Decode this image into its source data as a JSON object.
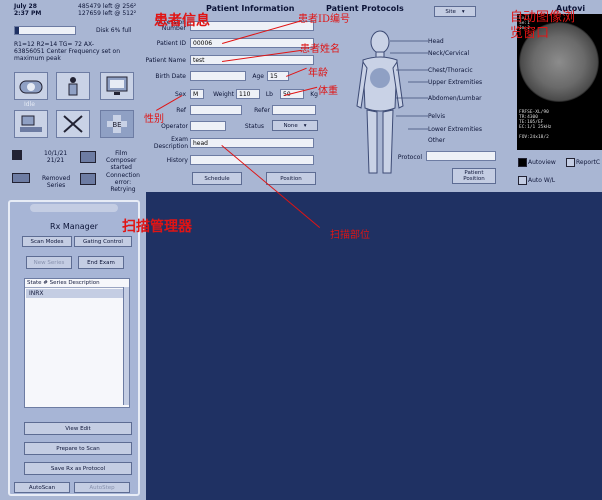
{
  "status": {
    "date": "July 28",
    "time": "2:37 PM",
    "disk_line1": "485479 left @ 256²",
    "disk_line2": "127659 left @ 512²",
    "disk_label": "Disk  6% full",
    "freq_line1": "R1=12  R2=14  TG= 72  AX-",
    "freq_line2": "63856051  Center Frequency set on",
    "freq_line3": "maximum peak",
    "idle_label": "Idle",
    "version": "10/1/21\n21/21",
    "film_status": "Film\nComposer\nstarted",
    "removed_label": "Removed\nSeries",
    "connection_status": "Connection\nerror:\nRetrying"
  },
  "patient": {
    "section_title": "Patient  Information",
    "accession_label": "Accession\nNumber",
    "patient_id_label": "Patient ID",
    "patient_id_value": "00006",
    "patient_name_label": "Patient Name",
    "patient_name_value": "test",
    "birth_date_label": "Birth Date",
    "age_label": "Age",
    "age_value": "15",
    "sex_label": "Sex",
    "sex_value": "M",
    "weight_label": "Weight",
    "weight_value": "110",
    "lb_label": "Lb",
    "height_value": "50",
    "kg_label": "Kg",
    "ref_label": "Ref",
    "refer_label": "Refer",
    "operator_label": "Operator",
    "status_label": "Status",
    "status_value": "None",
    "exam_label": "Exam\nDescription",
    "exam_value": "head",
    "history_label": "History",
    "schedule_button": "Schedule",
    "position_button": "Position"
  },
  "protocols": {
    "section_title": "Patient  Protocols",
    "site_select": "Site",
    "regions": [
      "Head",
      "Neck/Cervical",
      "Chest/Thoracic",
      "Upper Extremities",
      "Abdomen/Lumbar",
      "Pelvis",
      "Lower Extremities",
      "Other"
    ],
    "protocol_label": "Protocol",
    "patient_position_button": "Patient\nPosition"
  },
  "autoview": {
    "title": "Autovi",
    "image_top_text": "Ex:1\nSe:1\nIm:1",
    "image_side_text": "FRFSE-XL/90\nTR:4300\nTE:105/EF\nEC:1/1 25kHz\n\nFOV:24x18/2",
    "autoview_checkbox": "Autoview",
    "report_checkbox": "ReportC",
    "autowl_checkbox": "Auto W/L"
  },
  "rx_manager": {
    "title": "Rx Manager",
    "scan_modes_tab": "Scan Modes",
    "gating_control_tab": "Gating Control",
    "new_series_button": "New Series",
    "end_exam_button": "End Exam",
    "list_header": "State  #   Series Description",
    "list_items": [
      "INRX"
    ],
    "view_edit_button": "View Edit",
    "prepare_scan_button": "Prepare to Scan",
    "save_rx_button": "Save Rx as Protocol",
    "autoscan_button": "AutoScan",
    "autostep_button": "AutoStep"
  },
  "annotations": {
    "patient_info": "患者信息",
    "patient_id_note": "患者ID编号",
    "patient_name_note": "患者姓名",
    "age_note": "年龄",
    "weight_note": "体重",
    "sex_note": "性别",
    "exam_note": "扫描部位",
    "rx_note": "扫描管理器",
    "autoview_note": "自动图像浏\n览窗口"
  },
  "colors": {
    "panel": "#a9b6d3",
    "workspace": "#1f3163",
    "annotation": "#e01414"
  }
}
